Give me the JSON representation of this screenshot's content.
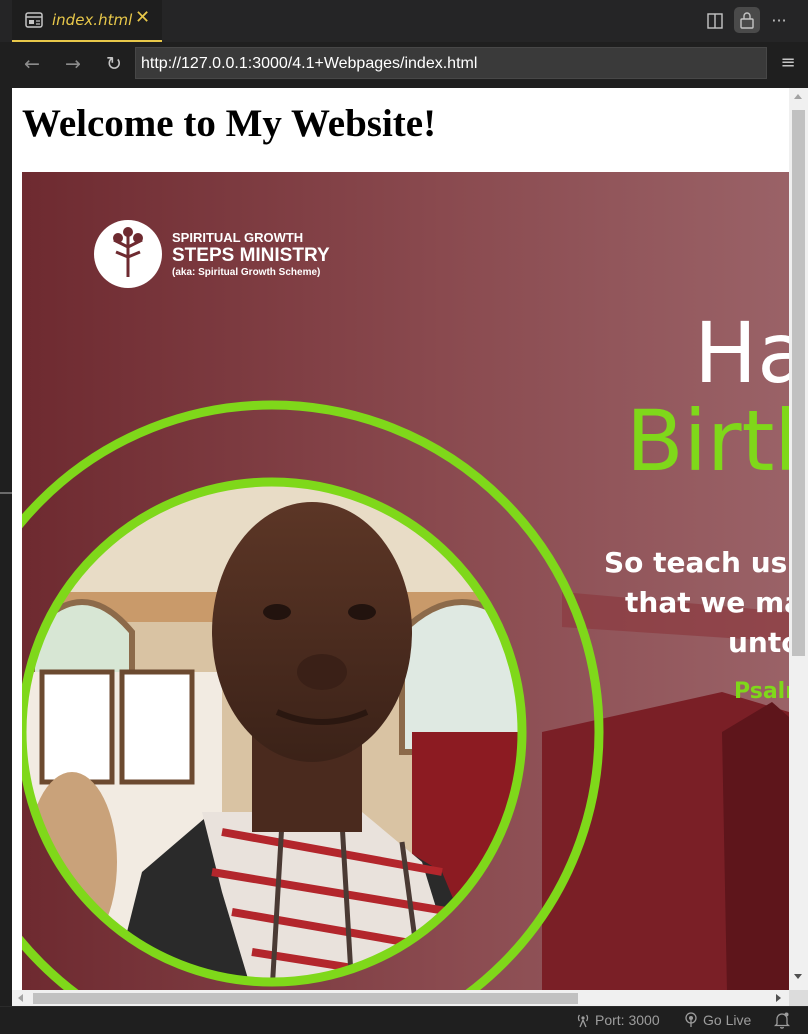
{
  "tab": {
    "title": "index.html",
    "close_glyph": "✕",
    "accent": "#e8c84a"
  },
  "toolbar": {
    "split_editor_icon": "split-editor-icon",
    "lock_icon": "lock-icon",
    "more_label": "···"
  },
  "nav": {
    "back_glyph": "←",
    "forward_glyph": "→",
    "reload_glyph": "↻",
    "url": "http://127.0.0.1:3000/4.1+Webpages/index.html",
    "menu_glyph": "≡"
  },
  "page": {
    "heading": "Welcome to My Website!",
    "banner": {
      "ministry_line1": "SPIRITUAL GROWTH",
      "ministry_line2": "STEPS MINISTRY",
      "ministry_line3": "(aka: Spiritual Growth Scheme)",
      "happy_text": "Ha",
      "birthday_text": "Birth",
      "verse_line1": "So teach us to",
      "verse_line2": "that we may",
      "verse_line3": "unto",
      "verse_ref": "Psalm",
      "bg_color": "#7e3a40",
      "ring_color": "#7fd81a"
    }
  },
  "statusbar": {
    "port_label": "Port: 3000",
    "golive_label": "Go Live"
  }
}
